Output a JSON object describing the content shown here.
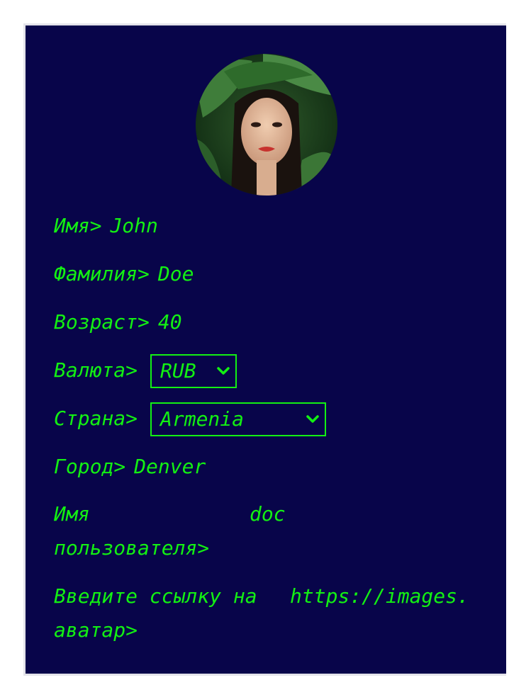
{
  "profile": {
    "avatar_alt": "avatar",
    "first_name": {
      "label": "Имя>",
      "value": "John"
    },
    "last_name": {
      "label": "Фамилия>",
      "value": "Doe"
    },
    "age": {
      "label": "Возраст>",
      "value": "40"
    },
    "currency": {
      "label": "Валюта>",
      "selected": "RUB"
    },
    "country": {
      "label": "Страна>",
      "selected": "Armenia"
    },
    "city": {
      "label": "Город>",
      "value": "Denver"
    },
    "username": {
      "label_line1": "Имя",
      "label_line2": "пользователя>",
      "value": "doc"
    },
    "avatar_url": {
      "label_line1": "Введите ссылку на",
      "label_line2": "аватар>",
      "value": "https://images."
    }
  },
  "colors": {
    "background": "#08054a",
    "text": "#13f013",
    "frame": "#e4e4ea"
  },
  "icons": {
    "select_chevron": "chevron-down-icon"
  }
}
